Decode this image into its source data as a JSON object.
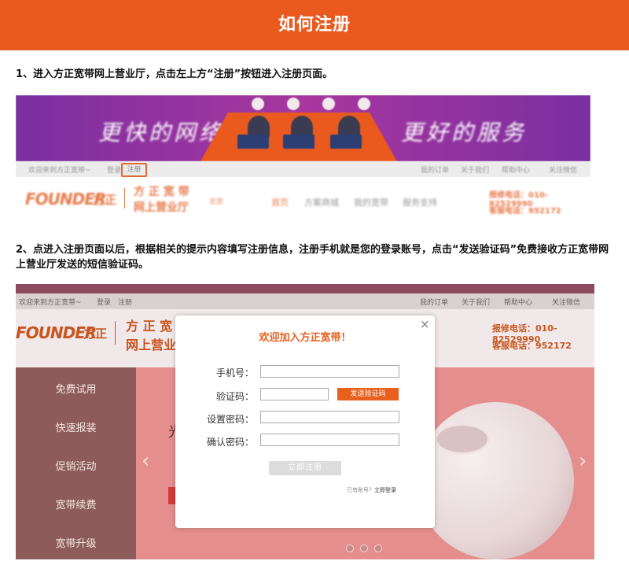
{
  "page": {
    "title": "如何注册"
  },
  "steps": {
    "step1": "1、进入方正宽带网上营业厅，点击左上方“注册”按钮进入注册页面。",
    "step2": "2、点进入注册页面以后，根据相关的提示内容填写注册信息，注册手机就是您的登录账号，点击“发送验证码”免费接收方正宽带网上营业厅发送的短信验证码。"
  },
  "screenshot1": {
    "banner_left": "更快的网络",
    "banner_right": "更好的服务",
    "subnav_welcome": "欢迎来到方正宽带~",
    "subnav_login": "登录",
    "subnav_register": "注册",
    "subnav_right": [
      "我的订单",
      "关于我们",
      "帮助中心",
      "关注微信"
    ],
    "logo_en": "FOUNDER",
    "logo_cn": "方正",
    "brand_line1": "方 正 宽 带",
    "brand_line2": "网上营业厅",
    "city": "北京",
    "nav": [
      "首页",
      "方案商城",
      "我的宽带",
      "服务支持"
    ],
    "report_phone": "报修电话：010-82529990",
    "service_phone": "客服电话：952172"
  },
  "screenshot2": {
    "topnav_welcome": "欢迎来到方正宽带~",
    "topnav_login": "登录",
    "topnav_register": "注册",
    "topnav_right": [
      "我的订单",
      "关于我们",
      "帮助中心",
      "关注微信"
    ],
    "logo_en": "FOUNDER",
    "logo_cn": "方正",
    "brand_line1": "方 正 宽",
    "brand_line2": "网上营业",
    "report_phone": "报修电话：010-82529990",
    "service_phone": "客服电话：952172",
    "menu": [
      "免费试用",
      "快速报装",
      "促销活动",
      "宽带续费",
      "宽带升级"
    ],
    "hero_fragment": "光",
    "slider_left_arrow": "‹",
    "slider_right_arrow": "›",
    "slide_count": 3
  },
  "modal": {
    "title": "欢迎加入方正宽带！",
    "close": "×",
    "phone_label": "手机号：",
    "code_label": "验证码：",
    "password_label": "设置密码：",
    "confirm_label": "确认密码：",
    "phone_value": "",
    "code_value": "",
    "password_value": "",
    "confirm_value": "",
    "send_code_button": "发送验证码",
    "submit_button": "立即注册",
    "login_hint": "已有账号？",
    "login_link": "立即登录"
  },
  "colors": {
    "brand": "#ea5a1f",
    "banner": "#a8379f"
  }
}
